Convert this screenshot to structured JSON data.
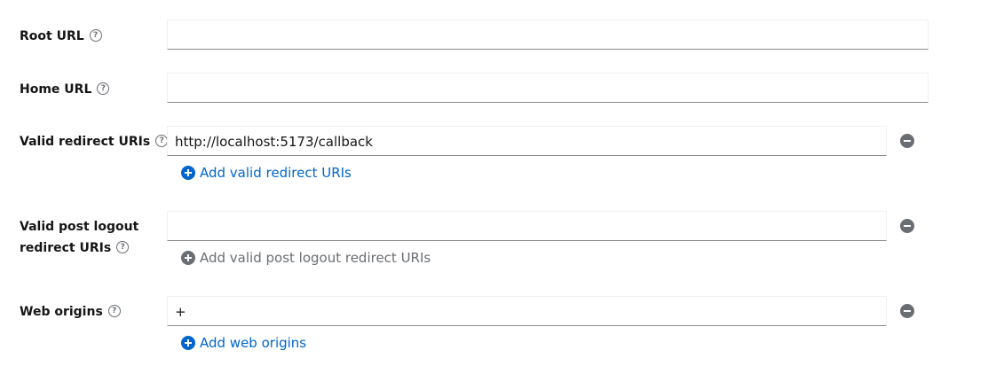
{
  "fields": {
    "root_url": {
      "label": "Root URL",
      "value": ""
    },
    "home_url": {
      "label": "Home URL",
      "value": ""
    },
    "valid_redirect": {
      "label": "Valid redirect URIs",
      "value": "http://localhost:5173/callback",
      "add_label": "Add valid redirect URIs"
    },
    "post_logout": {
      "label_line1": "Valid post logout",
      "label_line2": "redirect URIs",
      "value": "",
      "add_label": "Add valid post logout redirect URIs"
    },
    "web_origins": {
      "label": "Web origins",
      "value": "+",
      "add_label": "Add web origins"
    }
  },
  "icons": {
    "help": "help-circle-icon",
    "remove": "minus-circle-icon",
    "add": "plus-circle-icon"
  },
  "colors": {
    "link": "#0066cc",
    "disabled": "#6a6e73",
    "label": "#151515",
    "input_border_bottom": "#8a8d90"
  }
}
